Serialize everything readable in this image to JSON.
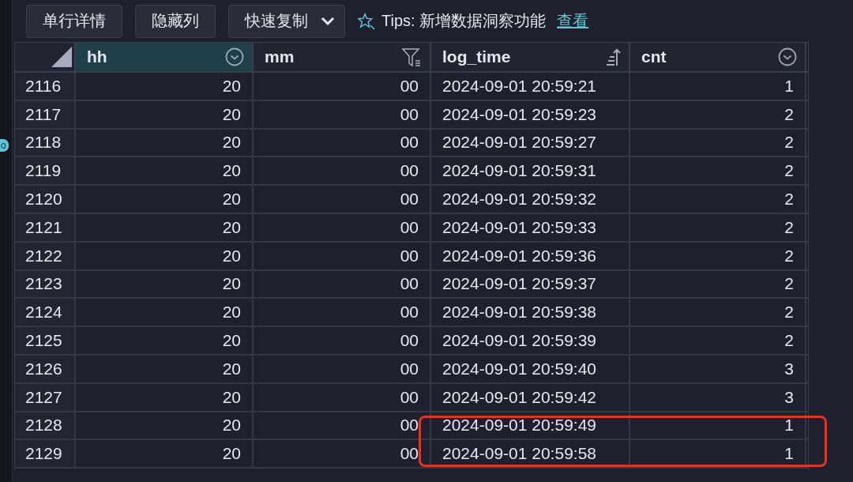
{
  "side_badge": {
    "label": "o"
  },
  "toolbar": {
    "buttons": [
      {
        "label": "单行详情",
        "kind": "plain"
      },
      {
        "label": "隐藏列",
        "kind": "plain"
      },
      {
        "label": "快速复制",
        "kind": "dropdown"
      }
    ],
    "tips": {
      "text": "Tips: 新增数据洞察功能",
      "link": "查看"
    }
  },
  "table": {
    "columns": [
      {
        "kind": "corner",
        "selected": false
      },
      {
        "label": "hh",
        "kind": "dropdown",
        "selected": true
      },
      {
        "label": "mm",
        "kind": "filter",
        "selected": false
      },
      {
        "label": "log_time",
        "kind": "sort",
        "selected": false
      },
      {
        "label": "cnt",
        "kind": "dropdown",
        "selected": false
      }
    ],
    "rows": [
      {
        "cells": [
          "2116",
          "20",
          "00",
          "2024-09-01 20:59:21",
          "1"
        ],
        "highlighted": false
      },
      {
        "cells": [
          "2117",
          "20",
          "00",
          "2024-09-01 20:59:23",
          "2"
        ],
        "highlighted": false
      },
      {
        "cells": [
          "2118",
          "20",
          "00",
          "2024-09-01 20:59:27",
          "2"
        ],
        "highlighted": false
      },
      {
        "cells": [
          "2119",
          "20",
          "00",
          "2024-09-01 20:59:31",
          "2"
        ],
        "highlighted": false
      },
      {
        "cells": [
          "2120",
          "20",
          "00",
          "2024-09-01 20:59:32",
          "2"
        ],
        "highlighted": false
      },
      {
        "cells": [
          "2121",
          "20",
          "00",
          "2024-09-01 20:59:33",
          "2"
        ],
        "highlighted": false
      },
      {
        "cells": [
          "2122",
          "20",
          "00",
          "2024-09-01 20:59:36",
          "2"
        ],
        "highlighted": false
      },
      {
        "cells": [
          "2123",
          "20",
          "00",
          "2024-09-01 20:59:37",
          "2"
        ],
        "highlighted": false
      },
      {
        "cells": [
          "2124",
          "20",
          "00",
          "2024-09-01 20:59:38",
          "2"
        ],
        "highlighted": false
      },
      {
        "cells": [
          "2125",
          "20",
          "00",
          "2024-09-01 20:59:39",
          "2"
        ],
        "highlighted": false
      },
      {
        "cells": [
          "2126",
          "20",
          "00",
          "2024-09-01 20:59:40",
          "3"
        ],
        "highlighted": false
      },
      {
        "cells": [
          "2127",
          "20",
          "00",
          "2024-09-01 20:59:42",
          "3"
        ],
        "highlighted": false
      },
      {
        "cells": [
          "2128",
          "20",
          "00",
          "2024-09-01 20:59:49",
          "1"
        ],
        "highlighted": true
      },
      {
        "cells": [
          "2129",
          "20",
          "00",
          "2024-09-01 20:59:58",
          "1"
        ],
        "highlighted": true
      }
    ]
  }
}
